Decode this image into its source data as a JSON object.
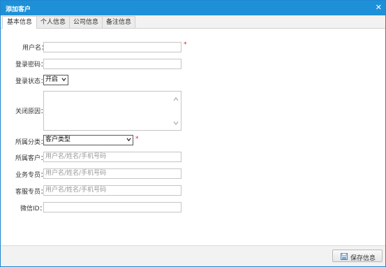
{
  "dialog": {
    "title": "添加客户"
  },
  "tabs": [
    {
      "label": "基本信息"
    },
    {
      "label": "个人信息"
    },
    {
      "label": "公司信息"
    },
    {
      "label": "备注信息"
    }
  ],
  "form": {
    "username_label": "用户名：",
    "password_label": "登录密码：",
    "login_status_label": "登录状态：",
    "login_status_value": "开启",
    "close_reason_label": "关闭原因：",
    "category_label": "所属分类：",
    "category_value": "客户类型",
    "owner_customer_label": "所属客户：",
    "owner_customer_placeholder": "用户名/姓名/手机号码",
    "sales_rep_label": "业务专员：",
    "sales_rep_placeholder": "用户名/姓名/手机号码",
    "service_rep_label": "客服专员：",
    "service_rep_placeholder": "用户名/姓名/手机号码",
    "wechat_label": "微信ID：",
    "required_mark": "*"
  },
  "footer": {
    "save_label": "保存信息"
  }
}
